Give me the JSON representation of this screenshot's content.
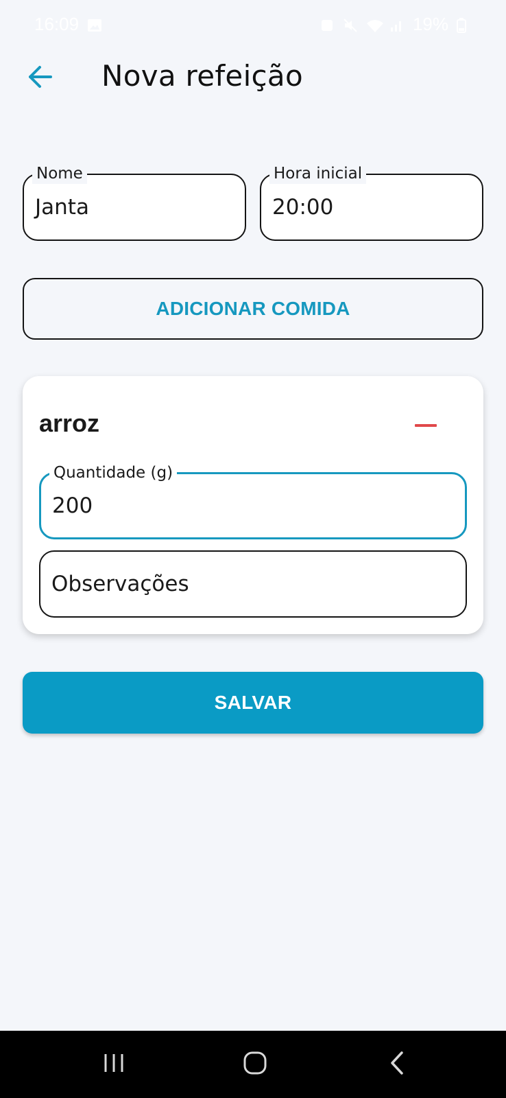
{
  "status_bar": {
    "time": "16:09",
    "battery": "19%",
    "icons": [
      "image-icon",
      "alarm-icon",
      "mute-icon",
      "wifi-icon",
      "signal-icon",
      "battery-icon"
    ]
  },
  "app_bar": {
    "back_icon": "arrow-left-icon",
    "title": "Nova refeição"
  },
  "form": {
    "name_field": {
      "label": "Nome",
      "value": "Janta"
    },
    "start_time_field": {
      "label": "Hora inicial",
      "value": "20:00"
    },
    "add_food_label": "ADICIONAR COMIDA"
  },
  "food_item": {
    "name": "arroz",
    "remove_icon": "minus-icon",
    "quantity_field": {
      "label": "Quantidade (g)",
      "value": "200"
    },
    "notes_field": {
      "placeholder": "Observações"
    }
  },
  "actions": {
    "save_label": "SALVAR"
  },
  "nav_bar": {
    "icons": [
      "recent-apps-icon",
      "home-icon",
      "back-nav-icon"
    ]
  },
  "colors": {
    "accent": "#1698bf",
    "save_button": "#0a9bc5",
    "remove": "#e0484a",
    "background": "#f4f6fa"
  }
}
